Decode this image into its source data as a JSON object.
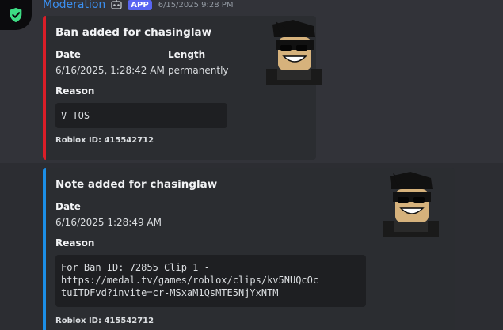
{
  "message": {
    "username": "Moderation",
    "badge": "APP",
    "timestamp": "6/15/2025 9:28 PM",
    "icons": {
      "avatar": "shield-check-icon",
      "bot": "robot-icon"
    }
  },
  "embeds": [
    {
      "title": "Ban added for chasinglaw",
      "accent": "#da1e28",
      "fields": [
        {
          "name": "Date",
          "value": "6/16/2025, 1:28:42 AM"
        },
        {
          "name": "Length",
          "value": "permanently"
        },
        {
          "name": "Reason",
          "value": "V-TOS"
        }
      ],
      "footer": "Roblox ID: 415542712",
      "thumbnail": "roblox-avatar"
    },
    {
      "title": "Note added for chasinglaw",
      "accent": "#1c8ee6",
      "fields": [
        {
          "name": "Date",
          "value": "6/16/2025 1:28:49 AM"
        },
        {
          "name": "Reason",
          "lines": [
            "For Ban ID: 72855 Clip 1 -",
            "https://medal.tv/games/roblox/clips/kv5NUQcOc",
            "tuITDFvd?invite=cr-MSxaM1QsMTE5NjYxNTM"
          ]
        }
      ],
      "footer": "Roblox ID: 415542712",
      "thumbnail": "roblox-avatar"
    }
  ]
}
